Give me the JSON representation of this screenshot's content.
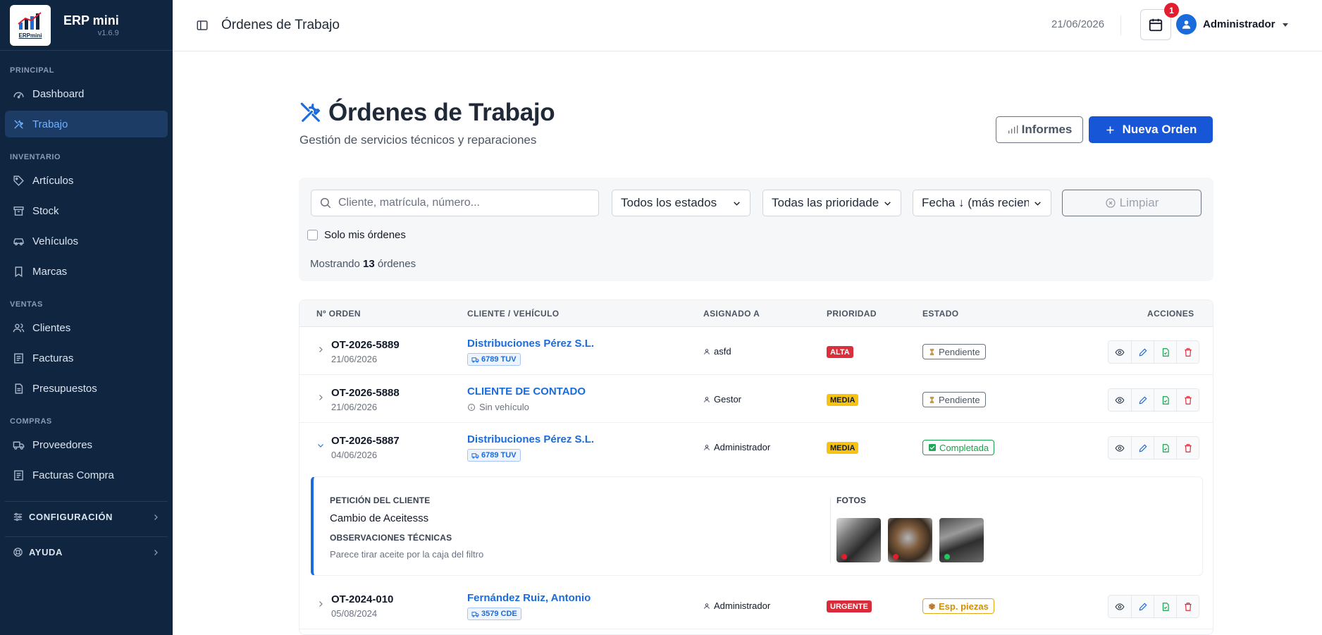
{
  "app": {
    "name": "ERP mini",
    "version": "v1.6.9",
    "logo_text": "ERPmini"
  },
  "sidebar": {
    "sections": [
      {
        "title": "PRINCIPAL",
        "items": [
          {
            "label": "Dashboard",
            "icon": "dashboard-icon"
          },
          {
            "label": "Trabajo",
            "icon": "tools-icon",
            "active": true
          }
        ]
      },
      {
        "title": "INVENTARIO",
        "items": [
          {
            "label": "Artículos",
            "icon": "tag-icon"
          },
          {
            "label": "Stock",
            "icon": "box-icon"
          },
          {
            "label": "Vehículos",
            "icon": "car-icon"
          },
          {
            "label": "Marcas",
            "icon": "bookmark-icon"
          }
        ]
      },
      {
        "title": "VENTAS",
        "items": [
          {
            "label": "Clientes",
            "icon": "users-icon"
          },
          {
            "label": "Facturas",
            "icon": "invoice-icon"
          },
          {
            "label": "Presupuestos",
            "icon": "document-icon"
          }
        ]
      },
      {
        "title": "COMPRAS",
        "items": [
          {
            "label": "Proveedores",
            "icon": "truck-icon"
          },
          {
            "label": "Facturas Compra",
            "icon": "invoice-icon"
          }
        ]
      }
    ],
    "groups": [
      {
        "label": "CONFIGURACIÓN",
        "icon": "sliders-icon"
      },
      {
        "label": "AYUDA",
        "icon": "lifebuoy-icon"
      }
    ]
  },
  "header": {
    "title": "Órdenes de Trabajo",
    "date": "21/06/2026",
    "notifications": "1",
    "user": "Administrador"
  },
  "main": {
    "title": "Órdenes de Trabajo",
    "subtitle": "Gestión de servicios técnicos y reparaciones",
    "btn_informes": "Informes",
    "btn_nueva": "Nueva Orden",
    "filters": {
      "search_placeholder": "Cliente, matrícula, número...",
      "estado": "Todos los estados",
      "prioridad": "Todas las prioridades",
      "orden": "Fecha ↓ (más recientes)",
      "limpiar": "Limpiar",
      "solo_mis": "Solo mis órdenes",
      "showing_prefix": "Mostrando",
      "showing_count": "13",
      "showing_suffix": "órdenes"
    },
    "table": {
      "headers": [
        "Nº ORDEN",
        "CLIENTE / VEHÍCULO",
        "ASIGNADO A",
        "PRIORIDAD",
        "ESTADO",
        "ACCIONES"
      ],
      "rows": [
        {
          "num": "OT-2026-5889",
          "date": "21/06/2026",
          "client": "Distribuciones Pérez S.L.",
          "plate": "6789 TUV",
          "assigned": "asfd",
          "priority": "ALTA",
          "state": "Pendiente"
        },
        {
          "num": "OT-2026-5888",
          "date": "21/06/2026",
          "client": "CLIENTE DE CONTADO",
          "no_vehicle": "Sin vehículo",
          "assigned": "Gestor",
          "priority": "MEDIA",
          "state": "Pendiente"
        },
        {
          "num": "OT-2026-5887",
          "date": "04/06/2026",
          "client": "Distribuciones Pérez S.L.",
          "plate": "6789 TUV",
          "assigned": "Administrador",
          "priority": "MEDIA",
          "state": "Completada"
        },
        {
          "num": "OT-2024-010",
          "date": "05/08/2024",
          "client": "Fernández Ruiz, Antonio",
          "plate": "3579 CDE",
          "assigned": "Administrador",
          "priority": "URGENTE",
          "state": "Esp. piezas"
        }
      ],
      "detail": {
        "peticion_label": "PETICIÓN DEL CLIENTE",
        "peticion": "Cambio de Aceitesss",
        "obs_label": "OBSERVACIONES TÉCNICAS",
        "obs": "Parece tirar aceite por la caja del filtro",
        "fotos_label": "FOTOS"
      }
    }
  },
  "colors": {
    "sidebar": "#0f2540",
    "accent": "#1856d8",
    "link": "#1a6bdb",
    "alta": "#dc2f3c",
    "media": "#f7c313",
    "urgente": "#d92c3a",
    "completada": "#16a34a",
    "esp_piezas": "#e6a817"
  }
}
